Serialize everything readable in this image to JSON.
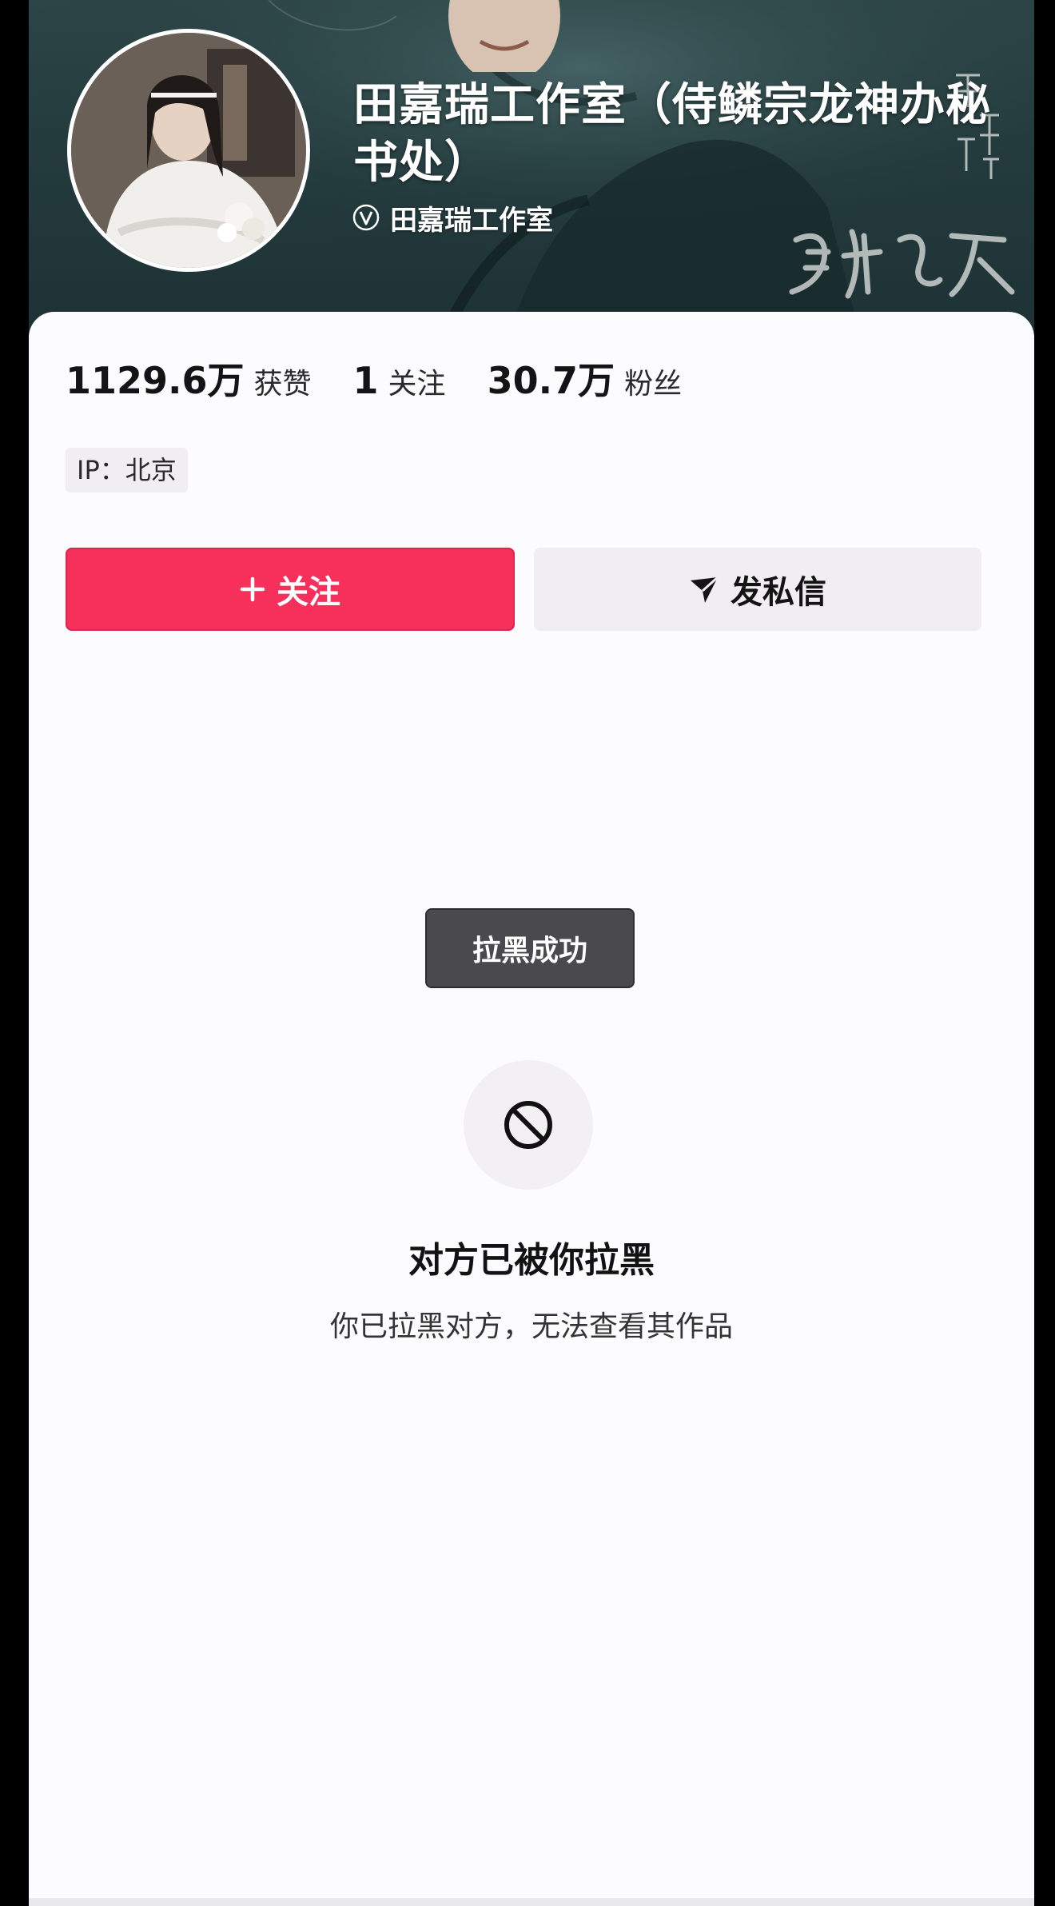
{
  "profile": {
    "name": "田嘉瑞工作室（侍鳞宗龙神办秘书处）",
    "verified_label": "田嘉瑞工作室"
  },
  "stats": [
    {
      "value": "1129.6万",
      "label": "获赞"
    },
    {
      "value": "1",
      "label": "关注"
    },
    {
      "value": "30.7万",
      "label": "粉丝"
    }
  ],
  "ip_location": "IP：北京",
  "actions": {
    "follow_label": "关注",
    "message_label": "发私信"
  },
  "toast": "拉黑成功",
  "blocked": {
    "title": "对方已被你拉黑",
    "description": "你已拉黑对方，无法查看其作品"
  },
  "colors": {
    "follow_button": "#f6305a",
    "banner": "#243b3d",
    "toast_bg": "#4a4a4e"
  },
  "icons": {
    "verified": "verified-v-icon",
    "follow": "plus-icon",
    "message": "send-arrow-icon",
    "blocked": "block-circle-icon"
  }
}
